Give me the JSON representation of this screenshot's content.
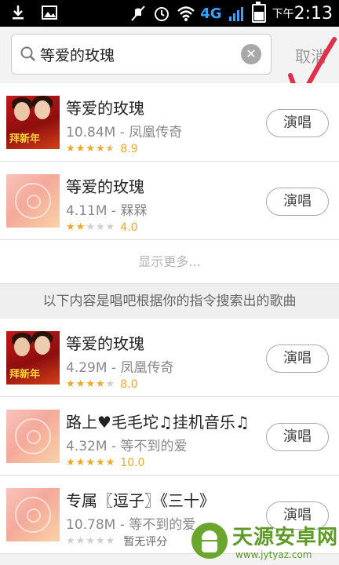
{
  "status_bar": {
    "network": "4G",
    "time_prefix": "下午",
    "time": "2:13"
  },
  "search": {
    "query": "等爱的玫瑰",
    "cancel_label": "取消"
  },
  "songs": [
    {
      "title": "等爱的玫瑰",
      "meta": "10.84M - 凤凰传奇",
      "rating": 4.5,
      "score": "8.9",
      "thumb": "album-art",
      "action": "演唱"
    },
    {
      "title": "等爱的玫瑰",
      "meta": "4.11M - 槑槑",
      "rating": 2,
      "score": "4.0",
      "thumb": "disc-icon",
      "action": "演唱"
    }
  ],
  "show_more_label": "显示更多...",
  "section_header": "以下内容是唱吧根据你的指令搜索出的歌曲",
  "songs_suggested": [
    {
      "title": "等爱的玫瑰",
      "meta": "4.29M - 凤凰传奇",
      "rating": 4,
      "score": "8.0",
      "thumb": "album-art",
      "action": "演唱"
    },
    {
      "title": "路上♥毛毛坨♫挂机音乐♫",
      "meta": "4.32M - 等不到的爱",
      "rating": 5,
      "score": "10.0",
      "thumb": "disc-icon",
      "action": "演唱"
    },
    {
      "title": "专属〖逗子〗《三十》",
      "meta": "10.78M - 等不到的爱",
      "rating": 0,
      "score": "暂无评分",
      "thumb": "disc-icon",
      "action": "演唱"
    }
  ],
  "album_art_text": "拜新年",
  "watermark": {
    "name": "天源安卓网",
    "url": "www.jytyaz.com"
  },
  "colors": {
    "star": "#f5a623",
    "annotation": "#e0304a",
    "status_bar": "#000000"
  }
}
